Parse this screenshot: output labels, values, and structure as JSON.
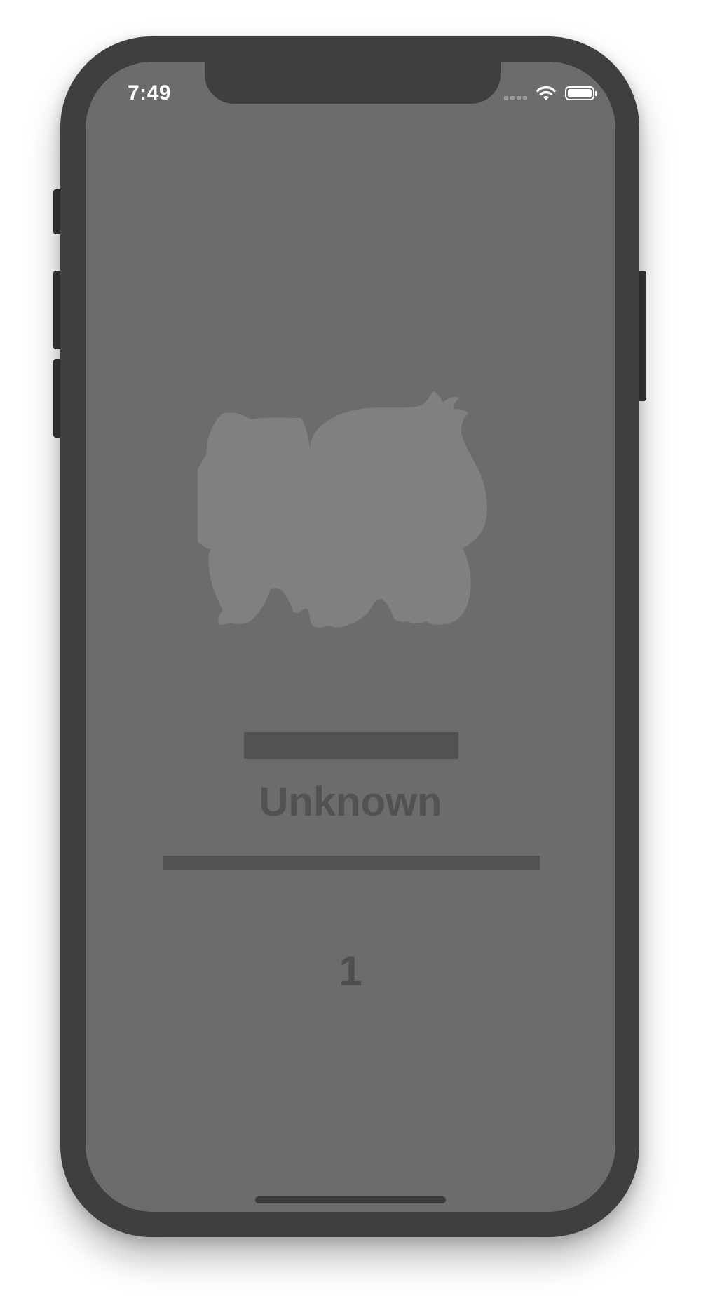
{
  "status_bar": {
    "time": "7:49",
    "battery_level": 1.0,
    "icons": [
      "cellular-signal-icon",
      "wifi-icon",
      "battery-icon"
    ]
  },
  "content": {
    "image": "pokemon-silhouette",
    "name": "Unknown",
    "number": "1"
  },
  "colors": {
    "frame": "#3f3f3f",
    "screen": "#6c6c6c",
    "silhouette": "#808080",
    "placeholder": "#525252",
    "status_text": "#ffffff"
  }
}
